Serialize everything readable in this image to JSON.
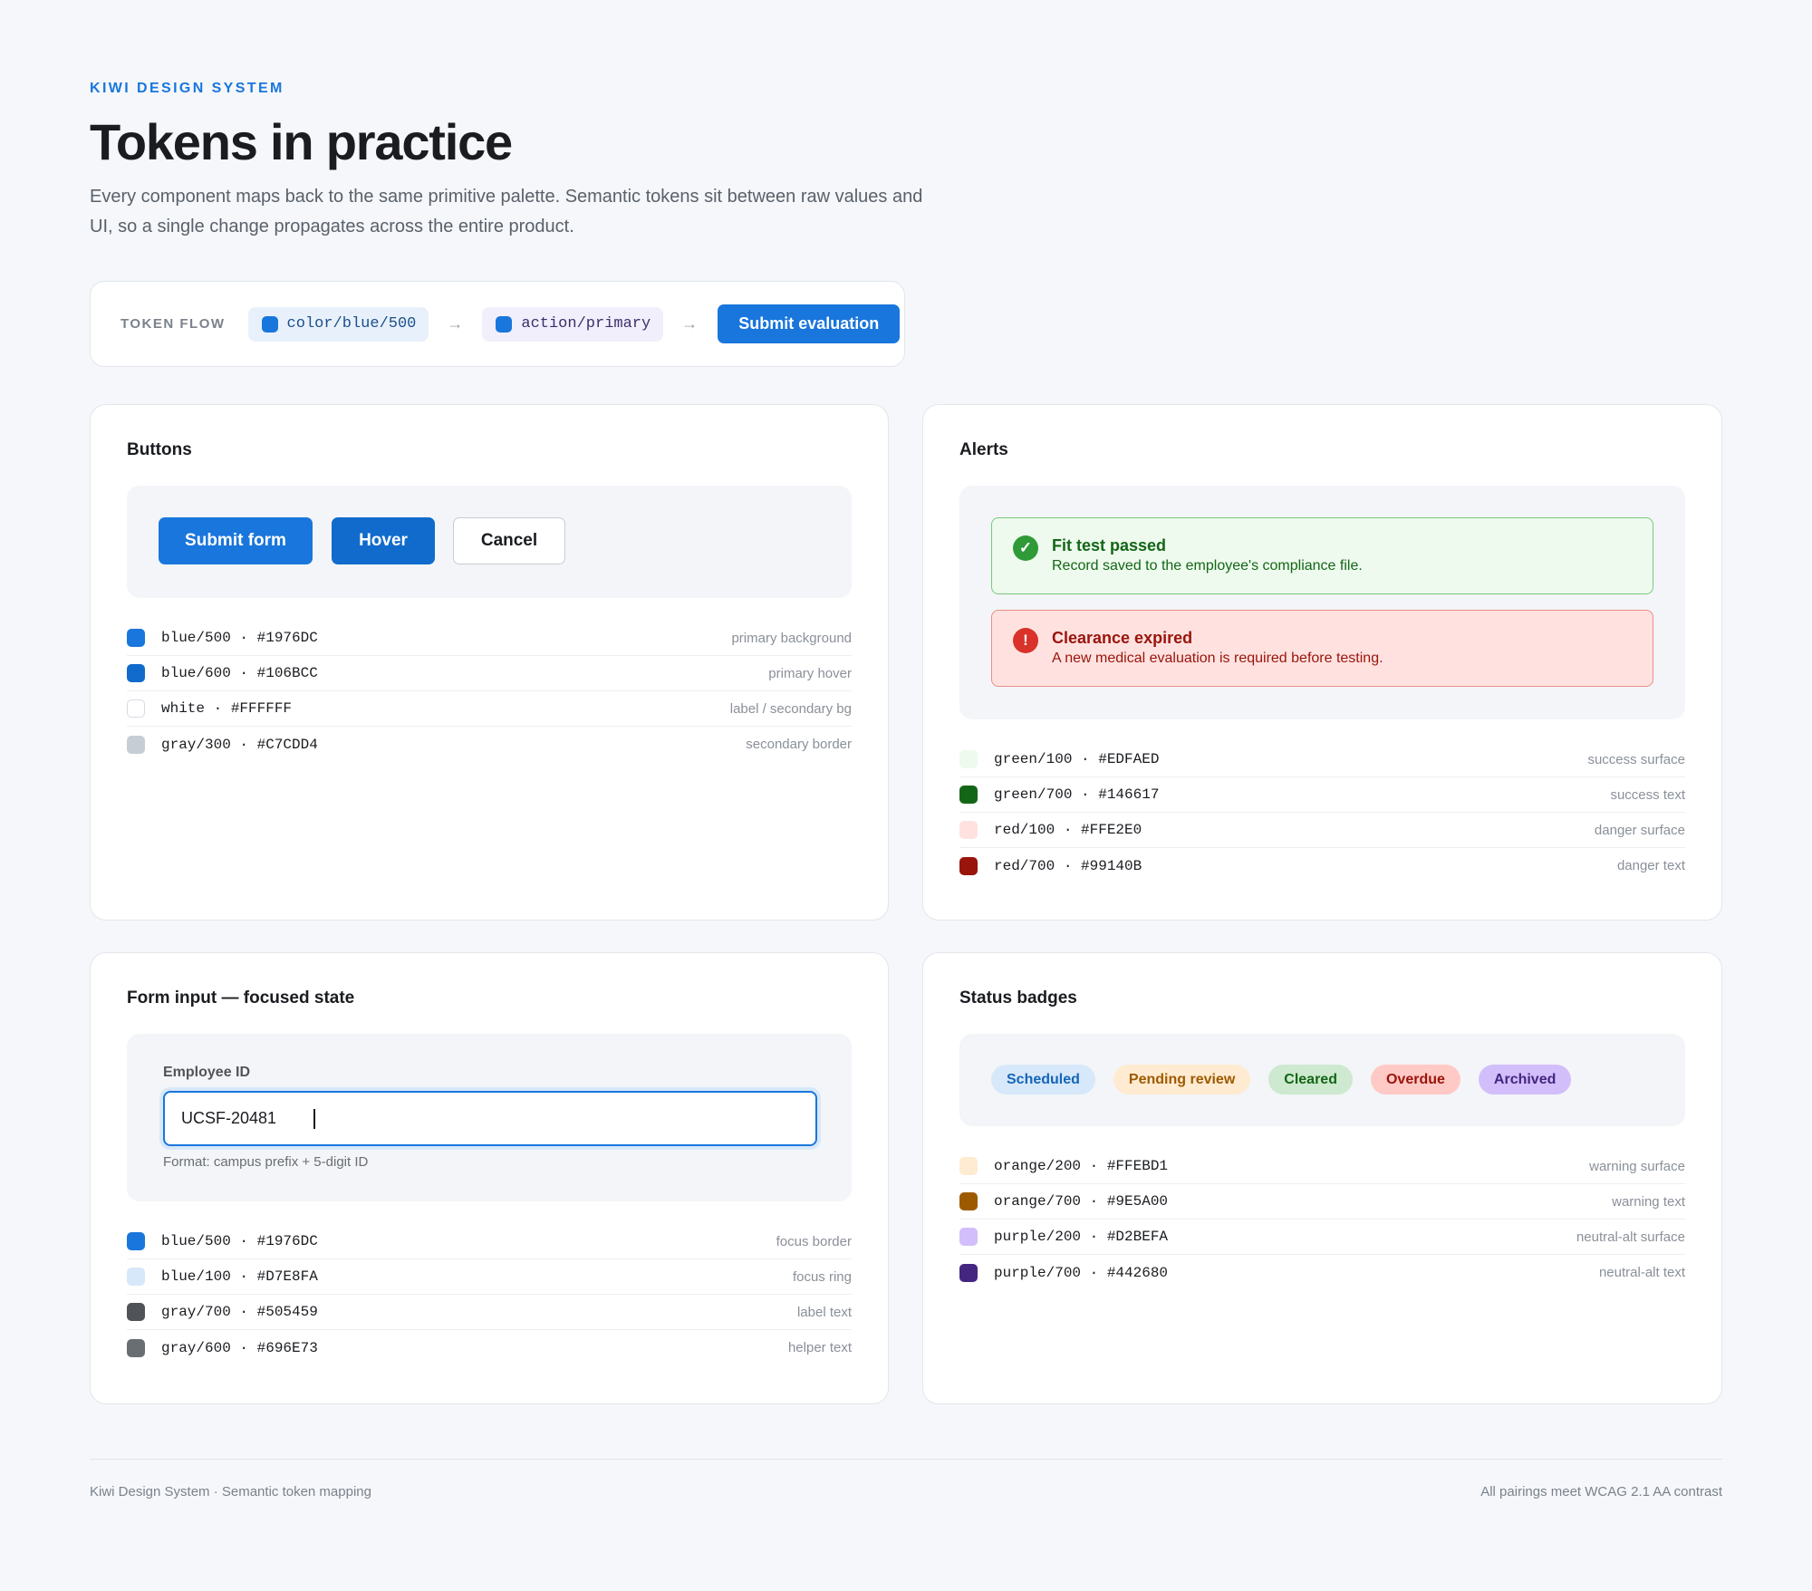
{
  "header": {
    "eyebrow": "KIWI DESIGN SYSTEM",
    "title": "Tokens in practice",
    "lead": "Every component maps back to the same primitive palette. Semantic tokens sit between raw values and UI, so a single change propagates across the entire product."
  },
  "token_flow": {
    "label": "TOKEN FLOW",
    "primitive": "color/blue/500",
    "semantic": "action/primary",
    "arrow": "→",
    "button_label": "Submit evaluation"
  },
  "buttons_card": {
    "title": "Buttons",
    "primary_label": "Submit form",
    "hover_label": "Hover",
    "cancel_label": "Cancel",
    "tokens": [
      {
        "name": "blue/500 · #1976DC",
        "role": "primary background",
        "color": "#1976DC"
      },
      {
        "name": "blue/600 · #106BCC",
        "role": "primary hover",
        "color": "#106BCC"
      },
      {
        "name": "white · #FFFFFF",
        "role": "label / secondary bg",
        "color": "#FFFFFF"
      },
      {
        "name": "gray/300 · #C7CDD4",
        "role": "secondary border",
        "color": "#C7CDD4"
      }
    ]
  },
  "alerts_card": {
    "title": "Alerts",
    "success": {
      "icon": "✓",
      "title": "Fit test passed",
      "body": "Record saved to the employee's compliance file."
    },
    "danger": {
      "icon": "!",
      "title": "Clearance expired",
      "body": "A new medical evaluation is required before testing."
    },
    "tokens": [
      {
        "name": "green/100 · #EDFAED",
        "role": "success surface",
        "color": "#EDFAED"
      },
      {
        "name": "green/700 · #146617",
        "role": "success text",
        "color": "#146617"
      },
      {
        "name": "red/100 · #FFE2E0",
        "role": "danger surface",
        "color": "#FFE2E0"
      },
      {
        "name": "red/700 · #99140B",
        "role": "danger text",
        "color": "#99140B"
      }
    ]
  },
  "form_card": {
    "title": "Form input — focused state",
    "field_label": "Employee ID",
    "field_value": "UCSF-20481",
    "helper": "Format: campus prefix + 5-digit ID",
    "tokens": [
      {
        "name": "blue/500 · #1976DC",
        "role": "focus border",
        "color": "#1976DC"
      },
      {
        "name": "blue/100 · #D7E8FA",
        "role": "focus ring",
        "color": "#D7E8FA"
      },
      {
        "name": "gray/700 · #505459",
        "role": "label text",
        "color": "#505459"
      },
      {
        "name": "gray/600 · #696E73",
        "role": "helper text",
        "color": "#696E73"
      }
    ]
  },
  "badges_card": {
    "title": "Status badges",
    "badges": [
      {
        "label": "Scheduled",
        "bg": "#D7E8FA",
        "fg": "#1565b8"
      },
      {
        "label": "Pending review",
        "bg": "#FFEBD1",
        "fg": "#9E5A00"
      },
      {
        "label": "Cleared",
        "bg": "#cde9cf",
        "fg": "#146617"
      },
      {
        "label": "Overdue",
        "bg": "#ffc9c5",
        "fg": "#99140B"
      },
      {
        "label": "Archived",
        "bg": "#D2BEFA",
        "fg": "#442680"
      }
    ],
    "tokens": [
      {
        "name": "orange/200 · #FFEBD1",
        "role": "warning surface",
        "color": "#FFEBD1"
      },
      {
        "name": "orange/700 · #9E5A00",
        "role": "warning text",
        "color": "#9E5A00"
      },
      {
        "name": "purple/200 · #D2BEFA",
        "role": "neutral-alt surface",
        "color": "#D2BEFA"
      },
      {
        "name": "purple/700 · #442680",
        "role": "neutral-alt text",
        "color": "#442680"
      }
    ]
  },
  "footer": {
    "left": "Kiwi Design System · Semantic token mapping",
    "right": "All pairings meet WCAG 2.1 AA contrast"
  }
}
